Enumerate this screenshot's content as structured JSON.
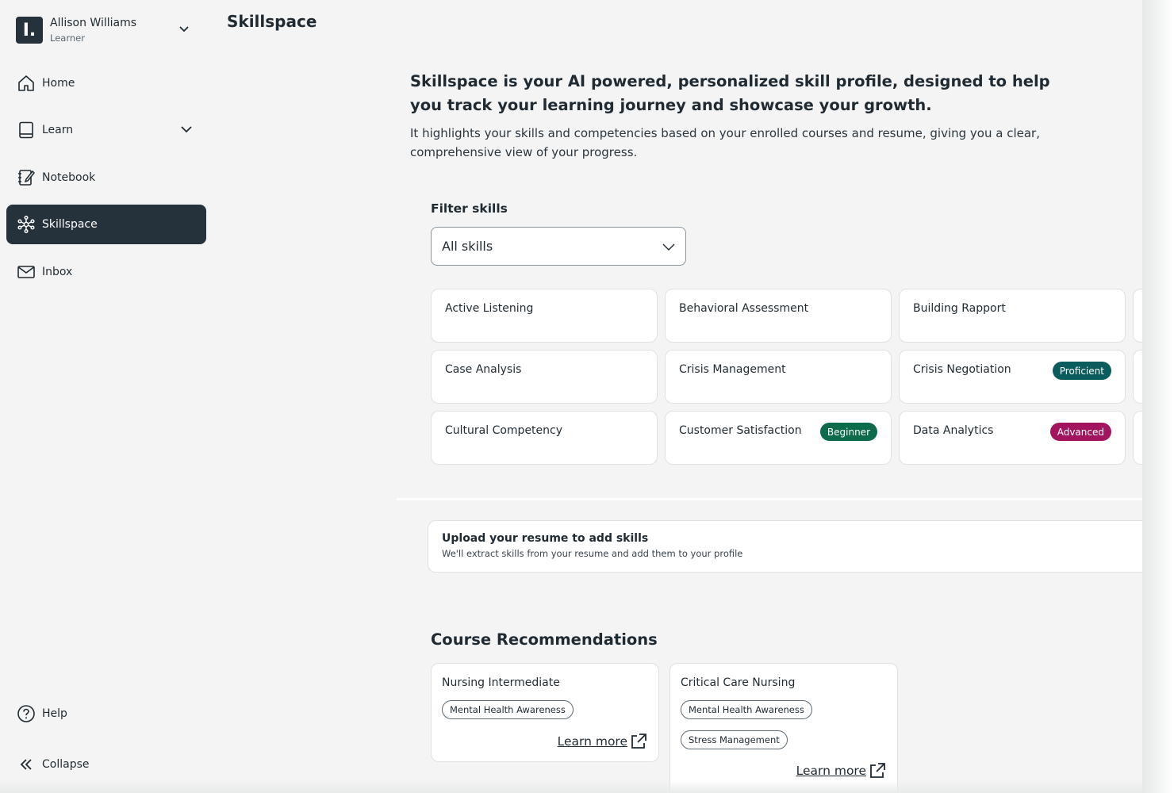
{
  "user": {
    "logo_letter": "I.",
    "name": "Allison Williams",
    "role": "Learner"
  },
  "nav": {
    "home": "Home",
    "learn": "Learn",
    "notebook": "Notebook",
    "skillspace": "Skillspace",
    "inbox": "Inbox",
    "help": "Help",
    "collapse": "Collapse"
  },
  "page": {
    "title": "Skillspace"
  },
  "intro": {
    "heading": "Skillspace is your AI powered, personalized skill profile, designed to help you track your learning journey and showcase your growth.",
    "body": "It highlights your skills and competencies based on your enrolled courses and resume, giving you a clear, comprehensive view of your progress."
  },
  "filter": {
    "label": "Filter skills",
    "selected": "All skills"
  },
  "skills": [
    {
      "name": "Active Listening",
      "badge": ""
    },
    {
      "name": "Behavioral Assessment",
      "badge": ""
    },
    {
      "name": "Building Rapport",
      "badge": ""
    },
    {
      "name": "Case Analysis",
      "badge": ""
    },
    {
      "name": "Crisis Management",
      "badge": ""
    },
    {
      "name": "Crisis Negotiation",
      "badge": "Proficient"
    },
    {
      "name": "Cultural Competency",
      "badge": ""
    },
    {
      "name": "Customer Satisfaction",
      "badge": "Beginner"
    },
    {
      "name": "Data Analytics",
      "badge": "Advanced"
    }
  ],
  "badge_colors": {
    "Proficient": "#0b5c5c",
    "Beginner": "#0b6b4a",
    "Advanced": "#a3145f"
  },
  "upload": {
    "title": "Upload your resume to add skills",
    "subtitle": "We'll extract skills from your resume and add them to your profile"
  },
  "recommendations": {
    "title": "Course Recommendations",
    "courses": [
      {
        "name": "Nursing Intermediate",
        "tags": [
          "Mental Health Awareness"
        ],
        "link": "Learn more"
      },
      {
        "name": "Critical Care Nursing",
        "tags": [
          "Mental Health Awareness",
          "Stress Management"
        ],
        "link": "Learn more"
      }
    ]
  }
}
